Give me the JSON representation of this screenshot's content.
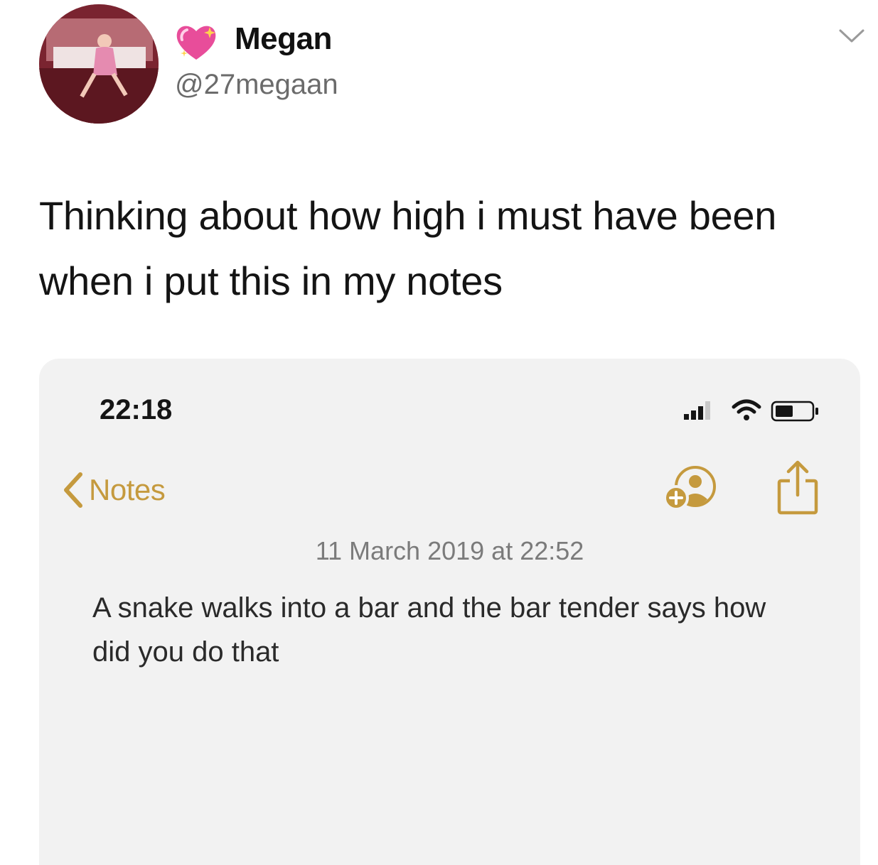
{
  "tweet": {
    "author_name": "Megan",
    "author_handle": "@27megaan",
    "text": "Thinking about how high i must have been when i put this in my notes"
  },
  "screenshot": {
    "status_time": "22:18",
    "back_label": "Notes",
    "note_date": "11 March 2019 at 22:52",
    "note_body": "A snake walks into a bar and the bar tender says how did you do that"
  },
  "icons": {
    "heart": "sparkling-heart-icon",
    "menu": "chevron-down-icon",
    "signal": "signal-icon",
    "wifi": "wifi-icon",
    "battery": "battery-icon",
    "back": "chevron-left-icon",
    "add_person": "add-person-icon",
    "share": "share-icon"
  },
  "colors": {
    "accent_gold": "#c59a3e",
    "heart_pink": "#e84d9a",
    "handle_gray": "#6b6b6b",
    "notes_bg": "#f2f2f2"
  }
}
